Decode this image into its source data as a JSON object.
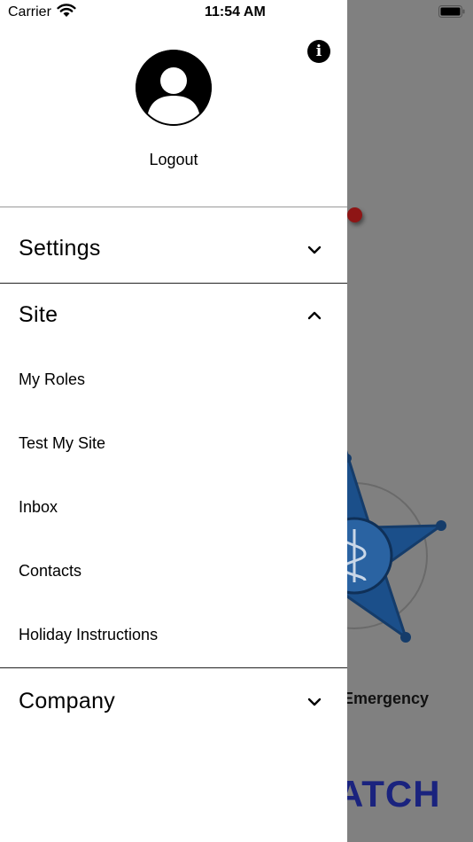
{
  "status_bar": {
    "carrier": "Carrier",
    "time": "11:54 AM",
    "wifi_icon": "wifi-icon",
    "battery_icon": "battery-icon"
  },
  "drawer": {
    "info_icon": "info-icon",
    "info_glyph": "i",
    "avatar_icon": "user-avatar-icon",
    "logout_label": "Logout",
    "sections": [
      {
        "title": "Settings",
        "expanded": false,
        "chevron_icon": "chevron-down-icon"
      },
      {
        "title": "Site",
        "expanded": true,
        "chevron_icon": "chevron-up-icon",
        "items": [
          {
            "label": "My Roles"
          },
          {
            "label": "Test My Site"
          },
          {
            "label": "Inbox"
          },
          {
            "label": "Contacts"
          },
          {
            "label": "Holiday Instructions"
          }
        ]
      },
      {
        "title": "Company",
        "expanded": false,
        "chevron_icon": "chevron-down-icon"
      }
    ]
  },
  "background_app": {
    "caption_text": "Emergency",
    "brand_text": "ATCH",
    "badge_color": "#1b4f8a",
    "marker_color": "#8e1515"
  }
}
